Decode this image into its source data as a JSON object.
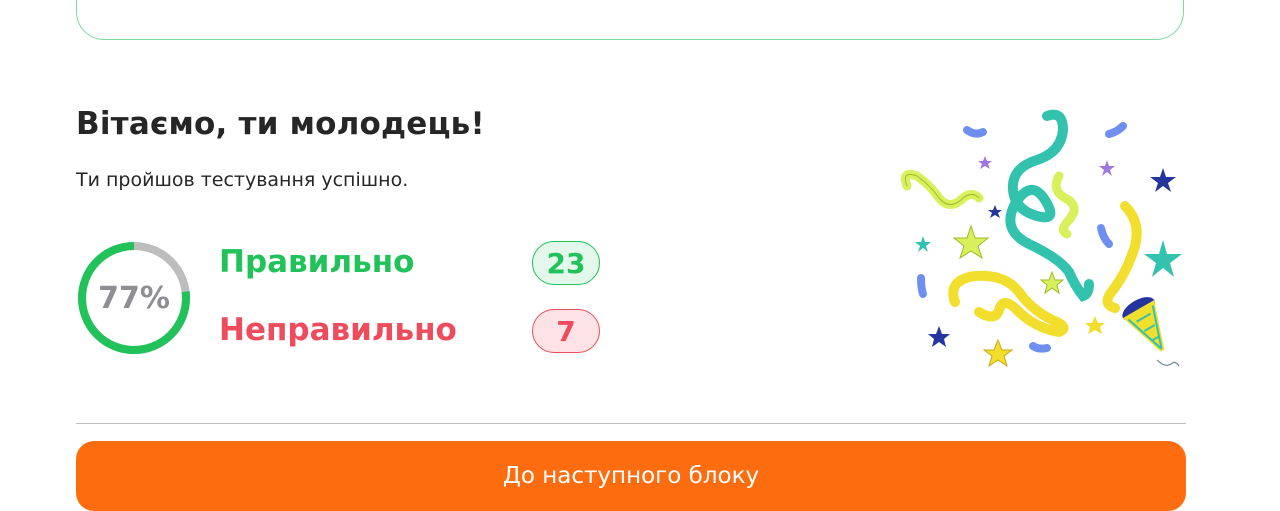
{
  "result": {
    "title": "Вітаємо, ти молодець!",
    "subtitle": "Ти пройшов тестування успішно.",
    "percent": 77,
    "percent_label": "77%",
    "correct_label": "Правильно",
    "correct_count": "23",
    "wrong_label": "Неправильно",
    "wrong_count": "7"
  },
  "actions": {
    "next_label": "До наступного блоку"
  },
  "colors": {
    "correct": "#22c25a",
    "wrong": "#ee4c5c",
    "ring_track": "#bdbdbd",
    "button": "#fd6d10"
  },
  "icons": {
    "illustration": "confetti-party-popper-icon"
  }
}
